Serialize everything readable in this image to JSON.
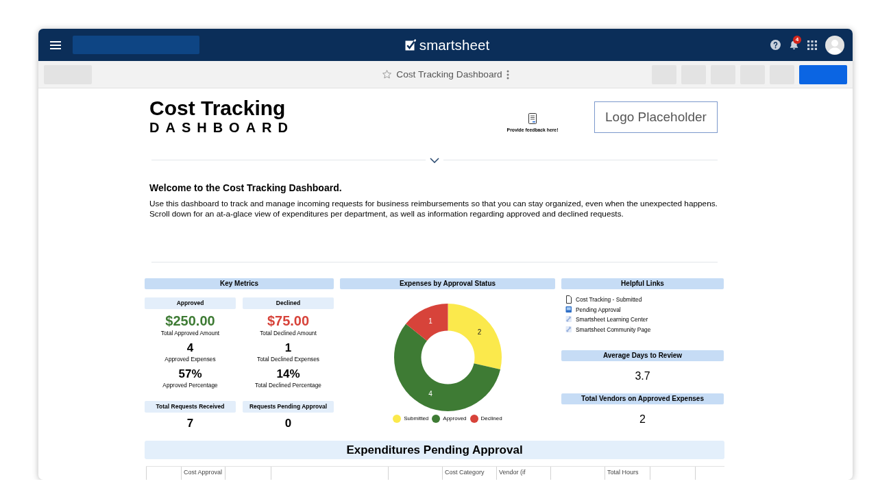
{
  "top_nav": {
    "logo_text": "smartsheet",
    "notification_count": "4"
  },
  "toolbar": {
    "title": "Cost Tracking Dashboard",
    "favorite": false
  },
  "header": {
    "title": "Cost Tracking",
    "subtitle": "DASHBOARD",
    "feedback_label": "Provide feedback here!",
    "logo_placeholder": "Logo Placeholder"
  },
  "welcome": {
    "heading": "Welcome to the Cost Tracking Dashboard.",
    "body": "Use this dashboard to track and manage incoming requests for business reimbursements so that you can stay organized, even when the unexpected happens. Scroll down for an at-a-glace view of expenditures per department, as well as information regarding approved and declined requests."
  },
  "key_metrics": {
    "title": "Key Metrics",
    "columns": [
      {
        "heading": "Approved",
        "amount": "$250.00",
        "color": "#3e7b34",
        "amount_label": "Total Approved Amount",
        "stats": [
          {
            "value": "4",
            "label": "Approved Expenses"
          },
          {
            "value": "57%",
            "label": "Approved Percentage"
          }
        ]
      },
      {
        "heading": "Declined",
        "amount": "$75.00",
        "color": "#d7433a",
        "amount_label": "Total Declined Amount",
        "stats": [
          {
            "value": "1",
            "label": "Total Declined Expenses"
          },
          {
            "value": "14%",
            "label": "Total Declined Percentage"
          }
        ]
      }
    ],
    "totals": [
      {
        "heading": "Total Requests Received",
        "value": "7"
      },
      {
        "heading": "Requests Pending Approval",
        "value": "0"
      }
    ]
  },
  "approval_chart": {
    "title": "Expenses by Approval Status",
    "chart_data": {
      "type": "donut",
      "values": [
        2,
        4,
        1
      ],
      "data_labels": true
    },
    "legend": [
      {
        "label": "Submitted",
        "color": "#fbe94c"
      },
      {
        "label": "Approved",
        "color": "#3e7b34"
      },
      {
        "label": "Declined",
        "color": "#d7433a"
      }
    ]
  },
  "helpful_links": {
    "title": "Helpful Links",
    "items": [
      {
        "kind": "sheet",
        "label": "Cost Tracking - Submitted"
      },
      {
        "kind": "report",
        "label": "Pending Approval"
      },
      {
        "kind": "link",
        "label": "Smartsheet Learning Center"
      },
      {
        "kind": "link",
        "label": "Smartsheet Community Page"
      }
    ]
  },
  "side_metrics": [
    {
      "heading": "Average Days to Review",
      "value": "3.7"
    },
    {
      "heading": "Total Vendors on Approved Expenses",
      "value": "2"
    }
  ],
  "pending": {
    "title": "Expenditures Pending Approval",
    "columns": [
      null,
      "Cost Approval",
      null,
      null,
      null,
      "Cost Category",
      "Vendor (if",
      null,
      "Total Hours",
      null,
      null
    ]
  }
}
